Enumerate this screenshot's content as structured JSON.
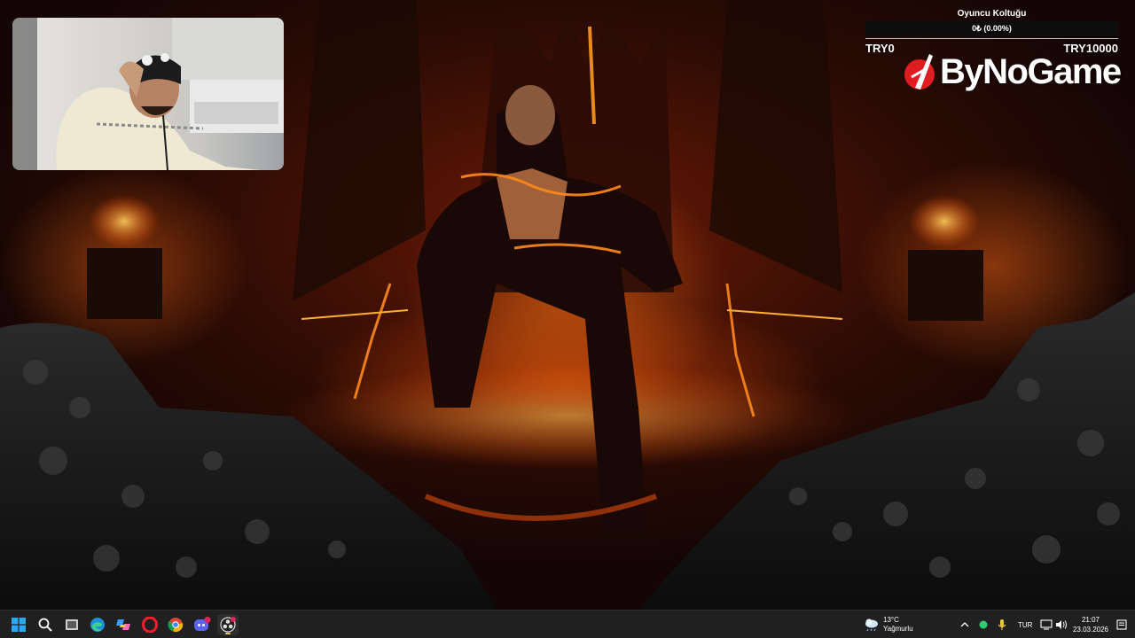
{
  "goal_widget": {
    "title": "Oyuncu Koltuğu",
    "progress_text": "0₺ (0.00%)",
    "progress_fraction": 0.0,
    "min_label": "TRY0",
    "max_label": "TRY10000",
    "bar_color": "#e11b22"
  },
  "brand": {
    "name": "ByNoGame",
    "icon": "bynogame-logo-icon",
    "accent": "#e11b22"
  },
  "webcam": {
    "icon": "webcam-feed"
  },
  "taskbar": {
    "pinned": [
      {
        "icon": "windows-start-icon"
      },
      {
        "icon": "search-icon"
      },
      {
        "icon": "task-view-icon"
      },
      {
        "icon": "edge-browser-icon"
      },
      {
        "icon": "copilot-icon"
      },
      {
        "icon": "opera-browser-icon"
      },
      {
        "icon": "chrome-browser-icon"
      },
      {
        "icon": "discord-icon",
        "badge": "99+"
      },
      {
        "icon": "obs-studio-icon"
      }
    ],
    "weather": {
      "temp": "13°C",
      "condition": "Yağmurlu",
      "icon": "rain-cloud-icon"
    },
    "tray": {
      "language": "TUR",
      "icons": [
        "chevron-up-icon",
        "green-status-dot-icon",
        "microphone-icon",
        "network-icon",
        "speaker-icon"
      ]
    },
    "clock": {
      "time": "21:07",
      "date": "23.03.2026"
    }
  }
}
